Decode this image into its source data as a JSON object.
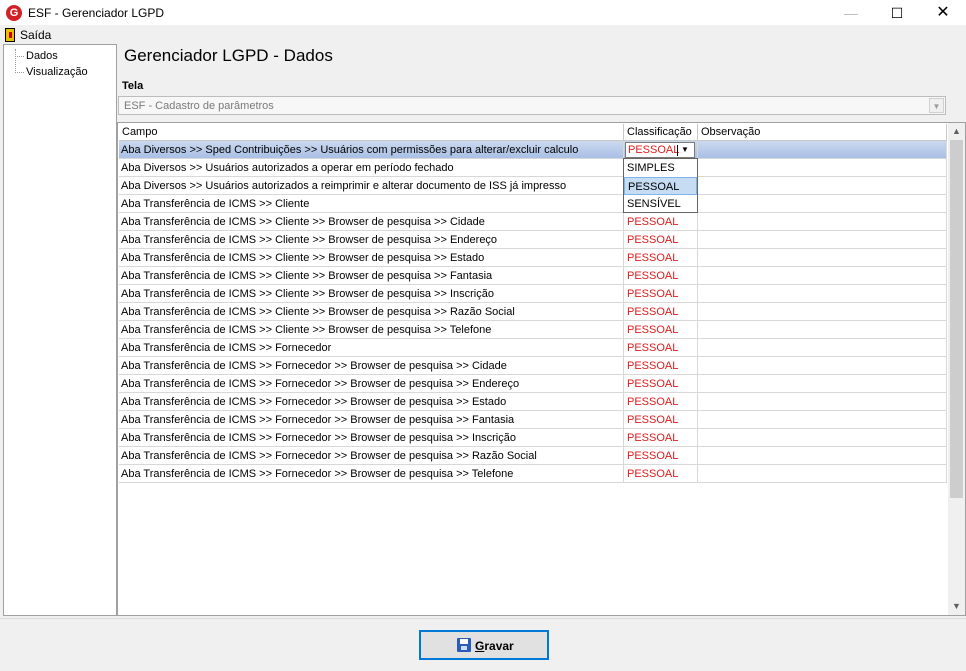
{
  "window": {
    "app_icon_letter": "G",
    "title": "ESF - Gerenciador LGPD",
    "minimize_glyph": "—",
    "maximize_glyph": "☐",
    "close_glyph": "✕"
  },
  "menu": {
    "exit_label": "Saída",
    "exit_icon": "exit-door-icon"
  },
  "tree": {
    "items": [
      "Dados",
      "Visualização"
    ]
  },
  "page": {
    "title": "Gerenciador LGPD - Dados"
  },
  "tela": {
    "label": "Tela",
    "value": "ESF - Cadastro de parâmetros",
    "arrow": "▼"
  },
  "grid": {
    "columns": [
      "Campo",
      "Classificação",
      "Observação"
    ],
    "selected_row": 0,
    "editor": {
      "value": "PESSOAL",
      "arrow": "▼"
    },
    "rows": [
      {
        "campo": "Aba Diversos >> Sped Contribuições >> Usuários com permissões para alterar/excluir calculo",
        "classificacao": "",
        "observacao": ""
      },
      {
        "campo": "Aba Diversos >> Usuários autorizados a operar em período fechado",
        "classificacao": "",
        "observacao": ""
      },
      {
        "campo": "Aba Diversos >> Usuários autorizados a reimprimir e alterar documento de ISS já impresso",
        "classificacao": "",
        "observacao": ""
      },
      {
        "campo": "Aba Transferência de ICMS >> Cliente",
        "classificacao": "",
        "observacao": ""
      },
      {
        "campo": "Aba Transferência de ICMS >> Cliente >> Browser de pesquisa >> Cidade",
        "classificacao": "PESSOAL",
        "observacao": ""
      },
      {
        "campo": "Aba Transferência de ICMS >> Cliente >> Browser de pesquisa >> Endereço",
        "classificacao": "PESSOAL",
        "observacao": ""
      },
      {
        "campo": "Aba Transferência de ICMS >> Cliente >> Browser de pesquisa >> Estado",
        "classificacao": "PESSOAL",
        "observacao": ""
      },
      {
        "campo": "Aba Transferência de ICMS >> Cliente >> Browser de pesquisa >> Fantasia",
        "classificacao": "PESSOAL",
        "observacao": ""
      },
      {
        "campo": "Aba Transferência de ICMS >> Cliente >> Browser de pesquisa >> Inscrição",
        "classificacao": "PESSOAL",
        "observacao": ""
      },
      {
        "campo": "Aba Transferência de ICMS >> Cliente >> Browser de pesquisa >> Razão Social",
        "classificacao": "PESSOAL",
        "observacao": ""
      },
      {
        "campo": "Aba Transferência de ICMS >> Cliente >> Browser de pesquisa >> Telefone",
        "classificacao": "PESSOAL",
        "observacao": ""
      },
      {
        "campo": "Aba Transferência de ICMS >> Fornecedor",
        "classificacao": "PESSOAL",
        "observacao": ""
      },
      {
        "campo": "Aba Transferência de ICMS >> Fornecedor >> Browser de pesquisa >> Cidade",
        "classificacao": "PESSOAL",
        "observacao": ""
      },
      {
        "campo": "Aba Transferência de ICMS >> Fornecedor >> Browser de pesquisa >> Endereço",
        "classificacao": "PESSOAL",
        "observacao": ""
      },
      {
        "campo": "Aba Transferência de ICMS >> Fornecedor >> Browser de pesquisa >> Estado",
        "classificacao": "PESSOAL",
        "observacao": ""
      },
      {
        "campo": "Aba Transferência de ICMS >> Fornecedor >> Browser de pesquisa >> Fantasia",
        "classificacao": "PESSOAL",
        "observacao": ""
      },
      {
        "campo": "Aba Transferência de ICMS >> Fornecedor >> Browser de pesquisa >> Inscrição",
        "classificacao": "PESSOAL",
        "observacao": ""
      },
      {
        "campo": "Aba Transferência de ICMS >> Fornecedor >> Browser de pesquisa >> Razão Social",
        "classificacao": "PESSOAL",
        "observacao": ""
      },
      {
        "campo": "Aba Transferência de ICMS >> Fornecedor >> Browser de pesquisa >> Telefone",
        "classificacao": "PESSOAL",
        "observacao": ""
      }
    ]
  },
  "dropdown": {
    "options": [
      "SIMPLES",
      "PESSOAL",
      "SENSÍVEL"
    ],
    "highlighted_index": 1
  },
  "scrollbar": {
    "up_arrow": "▲",
    "down_arrow": "▼"
  },
  "actions": {
    "save_prefix": "",
    "save_mnemonic": "G",
    "save_rest": "ravar",
    "save_icon": "floppy-disk-icon"
  },
  "colors": {
    "classification_text": "#e01c1c",
    "selected_row": "#a9bfe5",
    "accent": "#0078d7"
  }
}
